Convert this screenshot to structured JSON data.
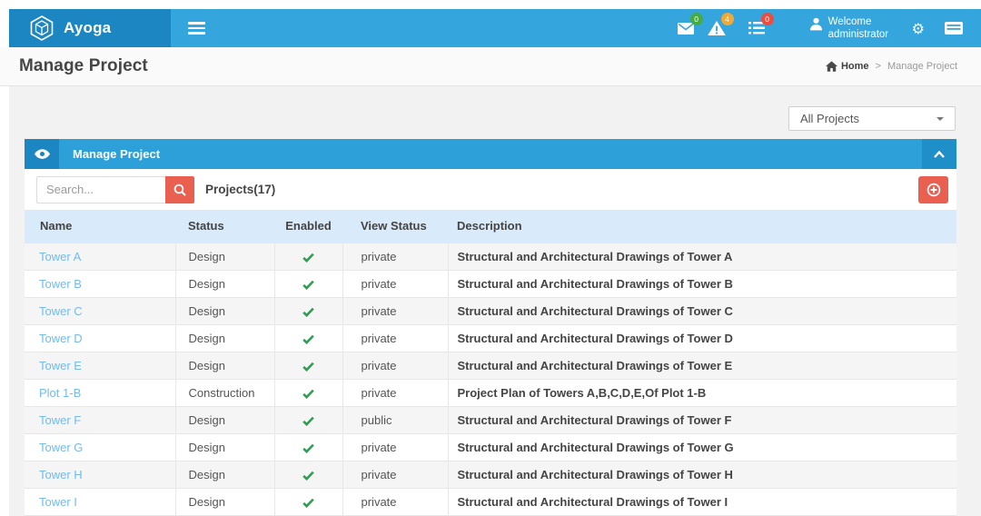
{
  "header": {
    "brand": "Ayoga",
    "notifications": [
      {
        "icon": "mail-icon",
        "badge": "0",
        "badge_color": "#47ab43"
      },
      {
        "icon": "warning-icon",
        "badge": "4",
        "badge_color": "#f0a839"
      },
      {
        "icon": "tasks-icon",
        "badge": "0",
        "badge_color": "#eb4d3f"
      }
    ],
    "welcome_line1": "Welcome",
    "welcome_line2": "administrator"
  },
  "page": {
    "title": "Manage Project",
    "breadcrumb_home": "Home",
    "breadcrumb_sep": ">",
    "breadcrumb_current": "Manage Project"
  },
  "filter": {
    "selected": "All Projects"
  },
  "panel": {
    "title": "Manage Project",
    "search_placeholder": "Search...",
    "projects_count_label": "Projects(17)"
  },
  "table": {
    "columns": [
      "Name",
      "Status",
      "Enabled",
      "View Status",
      "Description"
    ],
    "check_glyph": "✔",
    "rows": [
      {
        "name": "Tower A",
        "status": "Design",
        "enabled": true,
        "view_status": "private",
        "description": "Structural and Architectural Drawings of Tower A"
      },
      {
        "name": "Tower B",
        "status": "Design",
        "enabled": true,
        "view_status": "private",
        "description": "Structural and Architectural Drawings of Tower B"
      },
      {
        "name": "Tower C",
        "status": "Design",
        "enabled": true,
        "view_status": "private",
        "description": "Structural and Architectural Drawings of Tower C"
      },
      {
        "name": "Tower D",
        "status": "Design",
        "enabled": true,
        "view_status": "private",
        "description": "Structural and Architectural Drawings of Tower D"
      },
      {
        "name": "Tower E",
        "status": "Design",
        "enabled": true,
        "view_status": "private",
        "description": "Structural and Architectural Drawings of Tower E"
      },
      {
        "name": "Plot 1-B",
        "status": "Construction",
        "enabled": true,
        "view_status": "private",
        "description": "Project Plan of Towers A,B,C,D,E,Of Plot 1-B"
      },
      {
        "name": "Tower F",
        "status": "Design",
        "enabled": true,
        "view_status": "public",
        "description": "Structural and Architectural Drawings of Tower F"
      },
      {
        "name": "Tower G",
        "status": "Design",
        "enabled": true,
        "view_status": "private",
        "description": "Structural and Architectural Drawings of Tower G"
      },
      {
        "name": "Tower H",
        "status": "Design",
        "enabled": true,
        "view_status": "private",
        "description": "Structural and Architectural Drawings of Tower H"
      },
      {
        "name": "Tower I",
        "status": "Design",
        "enabled": true,
        "view_status": "private",
        "description": "Structural and Architectural Drawings of Tower I"
      }
    ]
  },
  "colors": {
    "header_blue": "#35a5de",
    "brand_dark_blue": "#1b86c2",
    "panel_header_blue": "#2d9fd9",
    "accent_red": "#ea6050",
    "table_header_blue": "#d9eafa",
    "link_blue": "#74bbe8",
    "check_green": "#2f9e52"
  }
}
